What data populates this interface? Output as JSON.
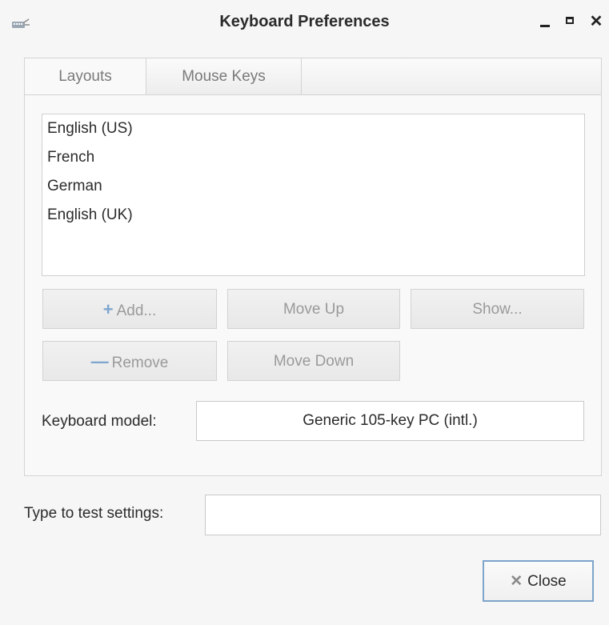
{
  "window": {
    "title": "Keyboard Preferences",
    "controls": {
      "minimize_icon": "minimize-icon",
      "maximize_icon": "maximize-icon",
      "close_glyph": "✕"
    }
  },
  "tabs": [
    {
      "label": "Layouts",
      "active": true
    },
    {
      "label": "Mouse Keys",
      "active": false
    }
  ],
  "layouts": [
    "English (US)",
    "French",
    "German",
    "English (UK)"
  ],
  "buttons": {
    "add_label": "Add...",
    "add_icon": "+",
    "remove_label": "Remove",
    "remove_icon": "—",
    "move_up_label": "Move Up",
    "move_down_label": "Move Down",
    "show_label": "Show..."
  },
  "keyboard_model": {
    "label": "Keyboard model:",
    "value": "Generic 105-key PC (intl.)"
  },
  "test": {
    "label": "Type to test settings:",
    "value": ""
  },
  "close_button": {
    "icon": "✕",
    "label": "Close"
  },
  "colors": {
    "accent": "#7da5cc",
    "disabled_text": "#9a9a9a"
  }
}
